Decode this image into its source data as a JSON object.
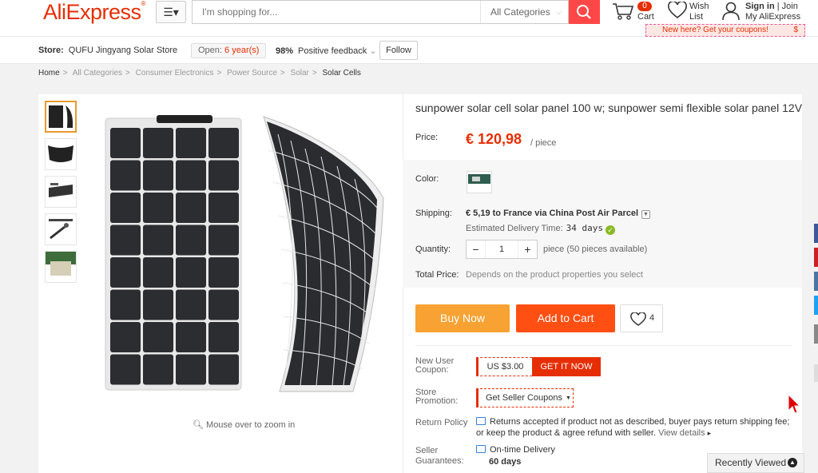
{
  "header": {
    "logo": "AliExpress",
    "search_placeholder": "I'm shopping for...",
    "search_category": "All Categories",
    "cart_count": "0",
    "cart_label": "Cart",
    "wish_label_1": "Wish",
    "wish_label_2": "List",
    "sign_in": "Sign in",
    "join_sep": "|",
    "join": "Join",
    "my_account": "My AliExpress",
    "coupon_promo": "New here? Get your coupons!",
    "coupon_dollar": "$"
  },
  "store": {
    "store_label": "Store:",
    "store_name": "QUFU Jingyang Solar Store",
    "open_label": "Open:",
    "open_years": "6 year(s)",
    "feedback_pct": "98%",
    "feedback_label": "Positive feedback",
    "feedback_chev": "⌄",
    "follow": "Follow"
  },
  "breadcrumb": [
    "Home",
    "All Categories",
    "Consumer Electronics",
    "Power Source",
    "Solar",
    "Solar Cells"
  ],
  "breadcrumb_sep": ">",
  "gallery": {
    "zoom_hint": "Mouse over to zoom in",
    "thumb_count": 5
  },
  "product": {
    "title": "sunpower solar cell solar panel 100 w; sunpower semi flexible solar panel 12V",
    "price_label": "Price:",
    "price": "€ 120,98",
    "price_unit": "/ piece",
    "color_label": "Color:",
    "shipping_label": "Shipping:",
    "shipping_value": "€ 5,19 to France via China Post Air Parcel",
    "delivery_label": "Estimated Delivery Time:",
    "delivery_days": "34 days",
    "quantity_label": "Quantity:",
    "quantity_value": "1",
    "quantity_minus": "−",
    "quantity_plus": "+",
    "quantity_note": "piece (50 pieces available)",
    "total_label": "Total Price:",
    "total_note": "Depends on the product properties you select",
    "buy_now": "Buy Now",
    "add_to_cart": "Add to Cart",
    "wish_count": "4",
    "new_user_coupon_label_1": "New User",
    "new_user_coupon_label_2": "Coupon:",
    "coupon_amount": "US $3.00",
    "coupon_get": "GET IT NOW",
    "store_promo_label_1": "Store",
    "store_promo_label_2": "Promotion:",
    "seller_coupons": "Get Seller Coupons",
    "return_label": "Return Policy",
    "return_text": "Returns accepted if product not as described, buyer pays return shipping fee; or keep the product & agree refund with seller.",
    "view_details": "View details",
    "view_details_chev": "▸",
    "guarantee_label_1": "Seller",
    "guarantee_label_2": "Guarantees:",
    "ontime": "On-time Delivery",
    "ontime_days": "60 days"
  },
  "recently_viewed": "Recently Viewed",
  "colors": {
    "brand": "#e62e04",
    "buy_now": "#f7a233",
    "add_to_cart": "#ff4f12",
    "share_facebook": "#3b5998",
    "share_pinterest": "#cb2027",
    "share_vk": "#4c75a3",
    "share_twitter": "#1da1f2",
    "share_other": "#888888"
  }
}
